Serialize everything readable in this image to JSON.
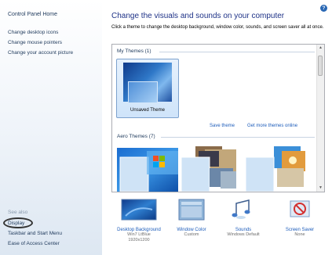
{
  "sidebar": {
    "home": "Control Panel Home",
    "links": [
      "Change desktop icons",
      "Change mouse pointers",
      "Change your account picture"
    ],
    "see_also": "See also",
    "see_also_links": [
      "Display",
      "Taskbar and Start Menu",
      "Ease of Access Center"
    ]
  },
  "main": {
    "help_glyph": "?",
    "title": "Change the visuals and sounds on your computer",
    "description": "Click a theme to change the desktop background, window color, sounds, and screen saver all at once.",
    "sections": {
      "my_themes": "My Themes (1)",
      "aero_themes": "Aero Themes (7)"
    },
    "themes": {
      "unsaved": "Unsaved Theme"
    },
    "save_theme": "Save theme",
    "get_more": "Get more themes online"
  },
  "bottom": [
    {
      "label": "Desktop Background",
      "sub1": "Win7 LtBlue",
      "sub2": "1920x1200"
    },
    {
      "label": "Window Color",
      "sub1": "Custom",
      "sub2": ""
    },
    {
      "label": "Sounds",
      "sub1": "Windows Default",
      "sub2": ""
    },
    {
      "label": "Screen Saver",
      "sub1": "None",
      "sub2": ""
    }
  ],
  "colors": {
    "link": "#1e5dbb",
    "title": "#1e3287",
    "sidebar_text": "#1e395b"
  }
}
